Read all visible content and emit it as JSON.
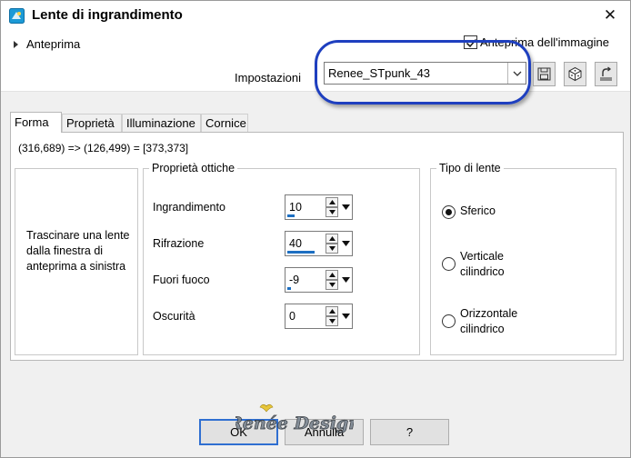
{
  "window": {
    "title": "Lente di ingrandimento",
    "close_glyph": "✕"
  },
  "top": {
    "preview_toggle_label": "Anteprima",
    "image_preview_label": "Anteprima dell'immagine",
    "image_preview_checked": true,
    "settings_label": "Impostazioni",
    "settings_value": "Renee_STpunk_43",
    "icons": [
      "save-icon",
      "randomize-dice-icon",
      "reset-icon"
    ]
  },
  "tabs": [
    {
      "label": "Forma",
      "active": true
    },
    {
      "label": "Proprietà",
      "active": false
    },
    {
      "label": "Illuminazione",
      "active": false
    },
    {
      "label": "Cornice",
      "active": false
    }
  ],
  "panel": {
    "coords_text": "(316,689) => (126,499) = [373,373]",
    "instructions_line1": "Trascinare una lente",
    "instructions_line2": "dalla finestra di",
    "instructions_line3": "anteprima a sinistra",
    "optical": {
      "title": "Proprietà ottiche",
      "fields": [
        {
          "label": "Ingrandimento",
          "value": "10",
          "fill_fraction": 0.1
        },
        {
          "label": "Rifrazione",
          "value": "40",
          "fill_fraction": 0.4
        },
        {
          "label": "Fuori fuoco",
          "value": "-9",
          "fill_fraction": 0.03
        },
        {
          "label": "Oscurità",
          "value": "0",
          "fill_fraction": 0.0
        }
      ]
    },
    "lens_type": {
      "title": "Tipo di lente",
      "options": [
        {
          "line1": "Sferico",
          "line2": "",
          "selected": true
        },
        {
          "line1": "Verticale",
          "line2": "cilindrico",
          "selected": false
        },
        {
          "line1": "Orizzontale",
          "line2": "cilindrico",
          "selected": false
        }
      ]
    }
  },
  "buttons": {
    "ok": "OK",
    "cancel": "Annulla",
    "help": "?"
  },
  "watermark": {
    "text": "Renée Design"
  },
  "colors": {
    "highlight_ring": "#1e3fbf",
    "accent": "#1d6fc2",
    "watermark": "#7a8590"
  }
}
